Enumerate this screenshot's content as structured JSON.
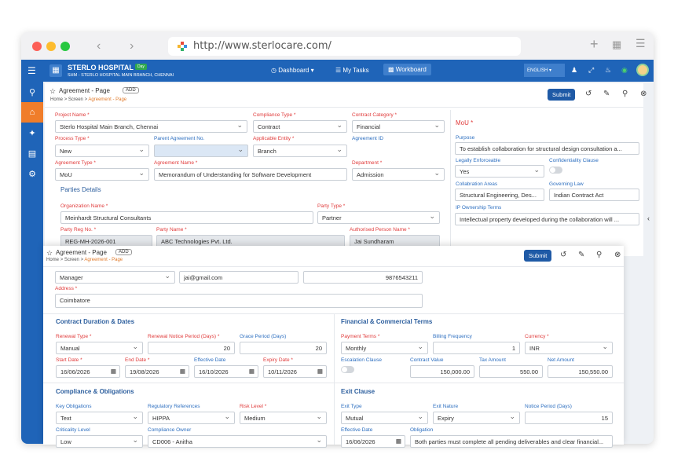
{
  "browser": {
    "url": "http://www.sterlocare.com/"
  },
  "app": {
    "hospital": "STERLO HOSPITAL",
    "badge": "Day",
    "branch": "SHM - STERLO HOSPITAL MAIN BRANCH, CHENNAI",
    "nav": [
      "Dashboard",
      "My Tasks",
      "Workboard"
    ],
    "language": "ENGLISH"
  },
  "page": {
    "title": "Agreement - Page",
    "add": "ADD",
    "crumbs": [
      "Home",
      ">",
      "Screen",
      ">",
      "Agreement - Page"
    ],
    "submit": "Submit"
  },
  "back": {
    "project_name_label": "Project Name *",
    "project_name": "Sterlo Hospital Main Branch, Chennai",
    "compliance_type_label": "Compliance Type *",
    "compliance_type": "Contract",
    "contract_category_label": "Contract Category *",
    "contract_category": "Financial",
    "process_type_label": "Process Type *",
    "process_type": "New",
    "parent_agreement_label": "Parent Agreement No.",
    "parent_agreement": "",
    "applicable_entity_label": "Applicable Entity *",
    "applicable_entity": "Branch",
    "agreement_id_label": "Agreement ID",
    "agreement_type_label": "Agreement Type *",
    "agreement_type": "MoU",
    "agreement_name_label": "Agreement Name *",
    "agreement_name": "Memorandum of Understanding for Software Development",
    "department_label": "Department *",
    "department": "Admission",
    "parties_title": "Parties Details",
    "org_name_label": "Organization Name *",
    "org_name": "Meinhardt Structural Consultants",
    "party_type_label": "Party Type *",
    "party_type": "Partner",
    "party_reg_label": "Party Reg No. *",
    "party_reg": "REG-MH-2026-001",
    "party_name_label": "Party Name *",
    "party_name": "ABC Technologies Pvt. Ltd.",
    "auth_person_label": "Authorised Person Name *",
    "auth_person": "Jai Sundharam",
    "mou_title": "MoU *",
    "purpose_label": "Purpose",
    "purpose": "To establish collaboration for structural design consultation a...",
    "legally_label": "Legally Enforceable",
    "legally": "Yes",
    "confidentiality_label": "Confidentiality Clause",
    "collab_label": "Collabration Areas",
    "collab": "Structural Engineering, Des...",
    "gov_law_label": "Governing Law",
    "gov_law": "Indian Contract Act",
    "ip_label": "IP Ownership Terms",
    "ip": "Intellectual property developed during the collaboration will ..."
  },
  "front": {
    "designation": "Manager",
    "email": "jai@gmail.com",
    "phone": "9876543211",
    "address_label": "Address *",
    "address": "Coimbatore",
    "contract_title": "Contract Duration & Dates",
    "renewal_type_label": "Renewal Type *",
    "renewal_type": "Manual",
    "renewal_notice_label": "Renewal Notice Period (Days) *",
    "renewal_notice": "20",
    "grace_label": "Grace Period (Days)",
    "grace": "20",
    "start_label": "Start Date *",
    "start": "16/06/2026",
    "end_label": "End Date *",
    "end": "19/08/2026",
    "effective_label": "Effective Date",
    "effective": "16/10/2026",
    "expiry_label": "Expiry Date *",
    "expiry": "10/11/2026",
    "financial_title": "Financial & Commercial Terms",
    "payment_terms_label": "Payment Terms *",
    "payment_terms": "Monthly",
    "billing_label": "Billing Frequency",
    "billing": "1",
    "currency_label": "Currency *",
    "currency": "INR",
    "escalation_label": "Escalation Clause",
    "contract_value_label": "Contract Value",
    "contract_value": "150,000.00",
    "tax_label": "Tax Amount",
    "tax": "550.00",
    "net_label": "Net Amount",
    "net": "150,550.00",
    "compliance_title": "Compliance & Obligations",
    "key_oblig_label": "Key Obligations",
    "key_oblig": "Text",
    "reg_ref_label": "Regulatory References",
    "reg_ref": "HIPPA",
    "risk_label": "Risk Level *",
    "risk": "Medium",
    "crit_label": "Criticality Level",
    "crit": "Low",
    "owner_label": "Compliance Owner",
    "owner": "CD006 - Anitha",
    "exit_title": "Exit Clause",
    "exit_type_label": "Exit Type",
    "exit_type": "Mutual",
    "exit_nature_label": "Exit Nature",
    "exit_nature": "Expiry",
    "notice_label": "Notice Period (Days)",
    "notice": "15",
    "exit_eff_label": "Effective Date",
    "exit_eff": "16/06/2026",
    "obligation_label": "Obligation",
    "obligation": "Both parties must complete all pending deliverables and clear financial..."
  }
}
